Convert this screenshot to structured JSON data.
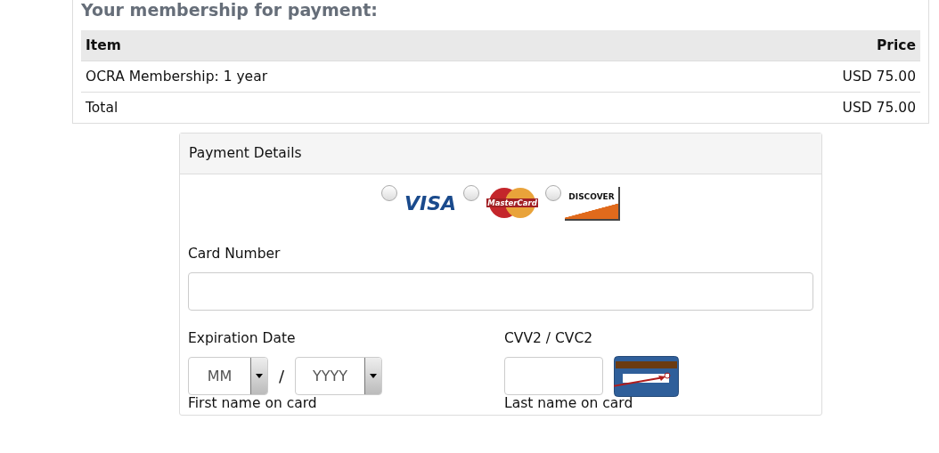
{
  "membership": {
    "heading": "Your membership for payment:",
    "columns": [
      "Item",
      "Price"
    ],
    "rows": [
      {
        "item": "OCRA Membership: 1 year",
        "price": "USD 75.00"
      },
      {
        "item": "Total",
        "price": "USD 75.00"
      }
    ]
  },
  "payment": {
    "title": "Payment Details",
    "cards": [
      {
        "kind": "visa",
        "label": "VISA",
        "selected": false
      },
      {
        "kind": "mastercard",
        "label": "MasterCard",
        "selected": false
      },
      {
        "kind": "discover",
        "label": "DISCOVER",
        "selected": false
      }
    ],
    "card_number": {
      "label": "Card Number"
    },
    "expiration": {
      "label": "Expiration Date",
      "month": "MM",
      "separator": "/",
      "year": "YYYY"
    },
    "cvv": {
      "label": "CVV2 / CVC2"
    },
    "first_name": {
      "label": "First name on card"
    },
    "last_name": {
      "label": "Last name on card"
    }
  }
}
